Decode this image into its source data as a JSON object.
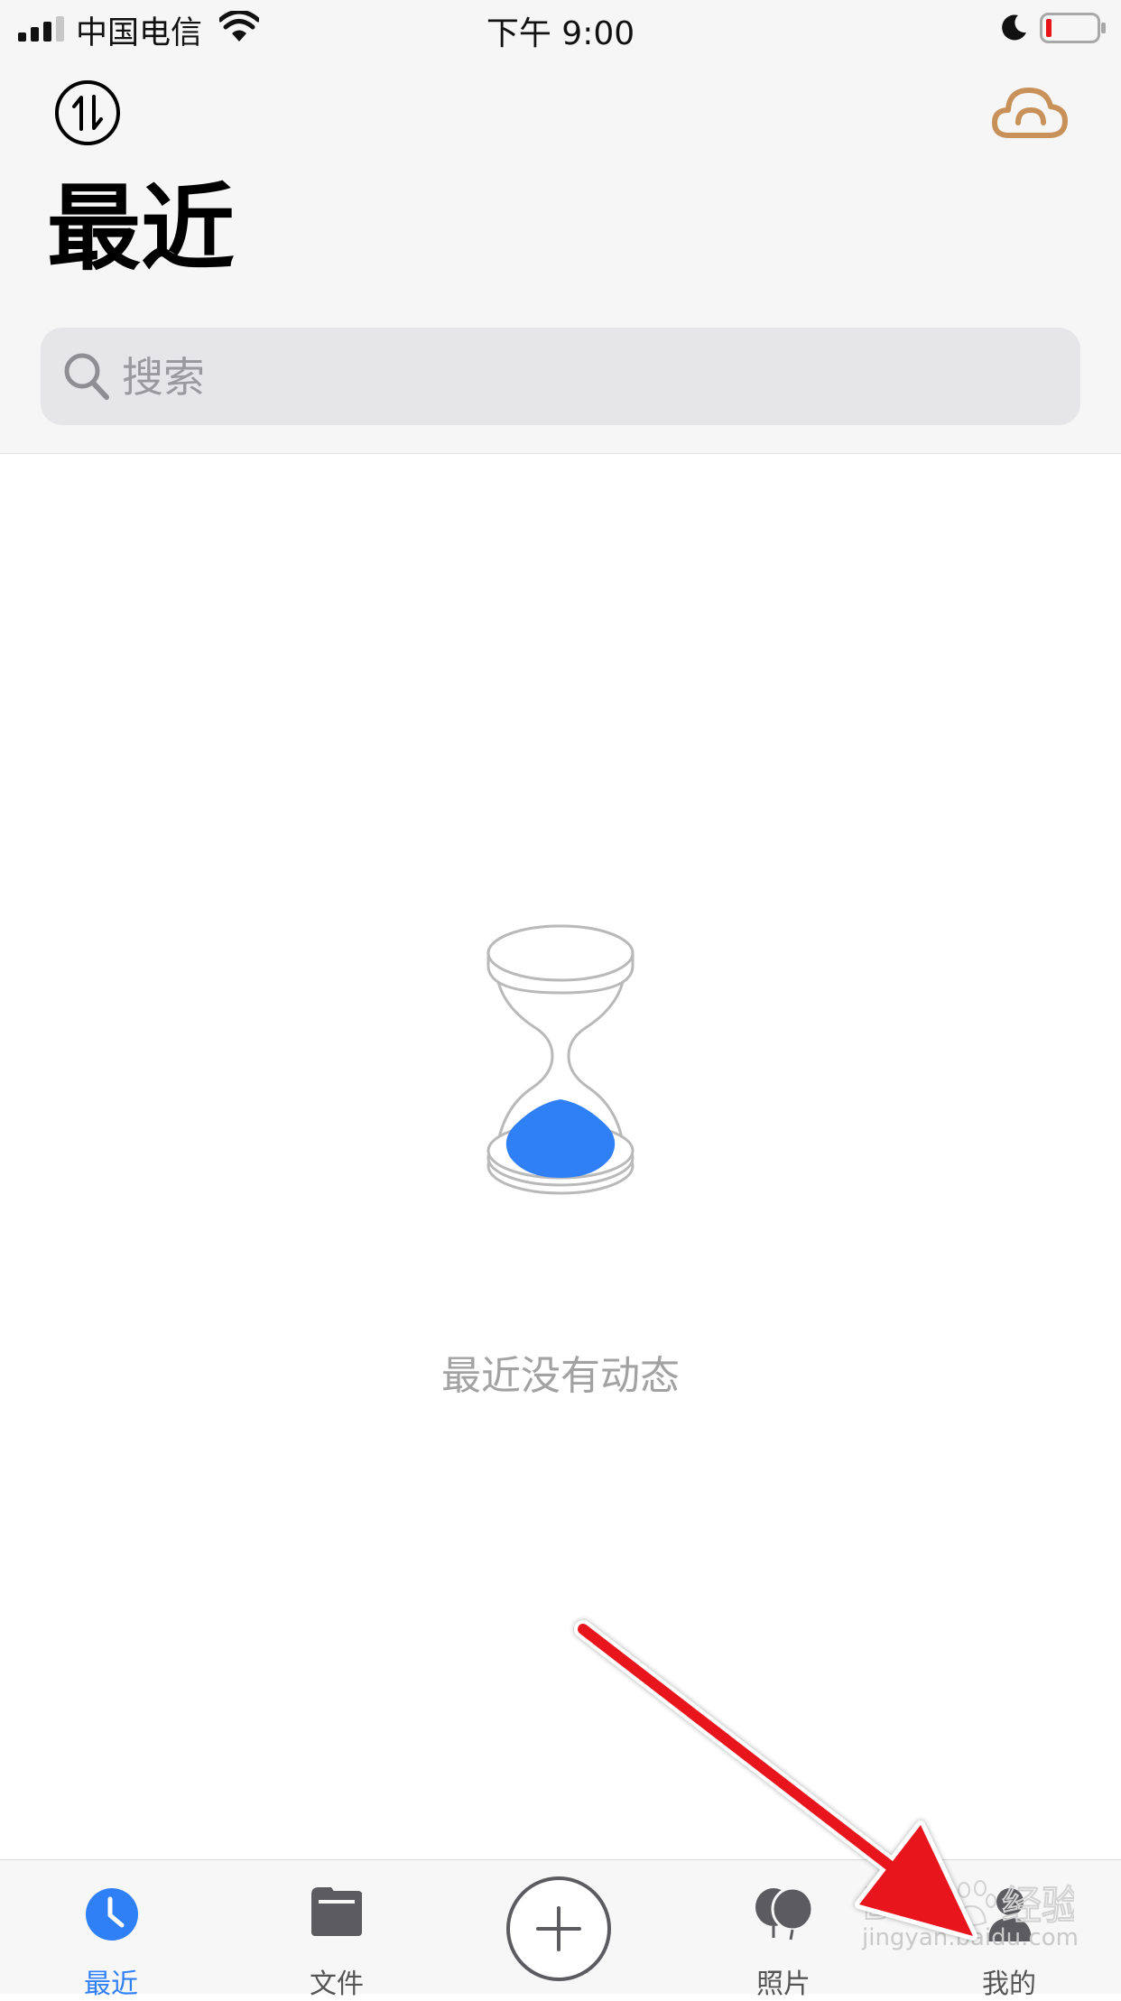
{
  "status_bar": {
    "carrier": "中国电信",
    "time": "下午 9:00"
  },
  "header": {
    "title": "最近"
  },
  "search": {
    "placeholder": "搜索"
  },
  "empty_state": {
    "message": "最近没有动态"
  },
  "tabbar": {
    "tabs": [
      {
        "label": "最近",
        "icon": "clock-icon",
        "active": true
      },
      {
        "label": "文件",
        "icon": "folder-icon",
        "active": false
      },
      {
        "label": "照片",
        "icon": "balloons-icon",
        "active": false
      },
      {
        "label": "我的",
        "icon": "person-icon",
        "active": false
      }
    ],
    "add_icon": "plus-circle-icon"
  },
  "colors": {
    "accent": "#2f80f7",
    "cloud": "#c8915a",
    "arrow": "#e8131b"
  },
  "watermark": {
    "text": "jingyan.baidu.com"
  }
}
